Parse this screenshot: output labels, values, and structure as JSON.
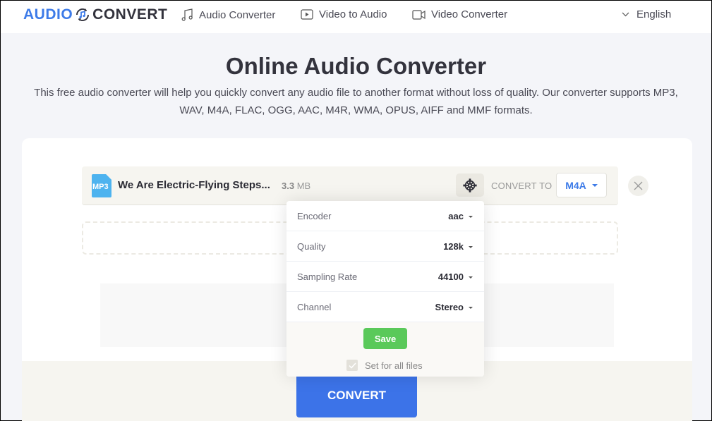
{
  "header": {
    "logo": {
      "part1": "AUDIO",
      "part2": "CONVERT",
      "icon": "sync-music-icon"
    },
    "nav": [
      {
        "label": "Audio Converter",
        "icon": "music-note-icon"
      },
      {
        "label": "Video to Audio",
        "icon": "play-box-icon"
      },
      {
        "label": "Video Converter",
        "icon": "video-camera-icon"
      }
    ],
    "language": {
      "label": "English",
      "icon": "chevron-down-icon"
    }
  },
  "hero": {
    "title": "Online Audio Converter",
    "description": "This free audio converter will help you quickly convert any audio file to another format without loss of quality. Our converter supports MP3, WAV, M4A, FLAC, OGG, AAC, M4R, WMA, OPUS, AIFF and MMF formats."
  },
  "file": {
    "type_badge": "MP3",
    "name": "We Are Electric-Flying Steps...",
    "size_value": "3.3",
    "size_unit": "MB",
    "convert_to_label": "CONVERT TO",
    "target_format": "M4A"
  },
  "settings": {
    "rows": [
      {
        "label": "Encoder",
        "value": "aac"
      },
      {
        "label": "Quality",
        "value": "128k"
      },
      {
        "label": "Sampling Rate",
        "value": "44100"
      },
      {
        "label": "Channel",
        "value": "Stereo"
      }
    ],
    "save_label": "Save",
    "set_all_label": "Set for all files",
    "set_all_checked": true
  },
  "convert_label": "CONVERT",
  "colors": {
    "accent": "#3d7be8",
    "save": "#5ac95a",
    "convert": "#3c73e8"
  }
}
